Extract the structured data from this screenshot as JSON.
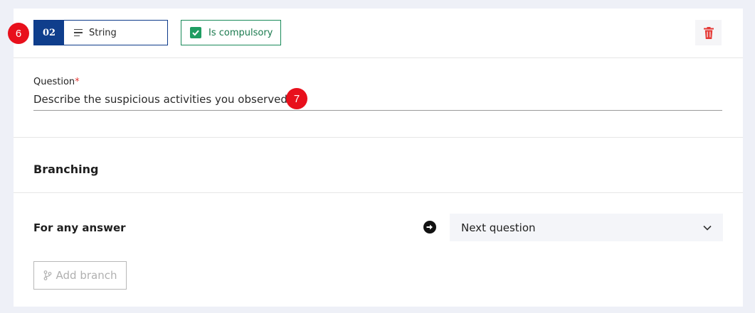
{
  "question_card": {
    "number": "02",
    "type_label": "String",
    "type_icon": "text-lines-icon",
    "compulsory_label": "Is compulsory",
    "compulsory_checked": true,
    "delete_icon": "trash-icon",
    "question_label": "Question",
    "required_marker": "*",
    "question_value": "Describe the suspicious activities you observed"
  },
  "branching": {
    "title": "Branching",
    "any_answer_label": "For any answer",
    "arrow_icon": "arrow-right-circle-icon",
    "next_select_value": "Next question",
    "add_branch_label": "Add branch",
    "add_branch_icon": "branch-icon"
  },
  "markers": [
    "6",
    "7"
  ],
  "colors": {
    "accent_blue": "#0f3e8c",
    "compulsory_green": "#1f9d62",
    "delete_red": "#e53935",
    "marker_red": "#e8101c"
  }
}
